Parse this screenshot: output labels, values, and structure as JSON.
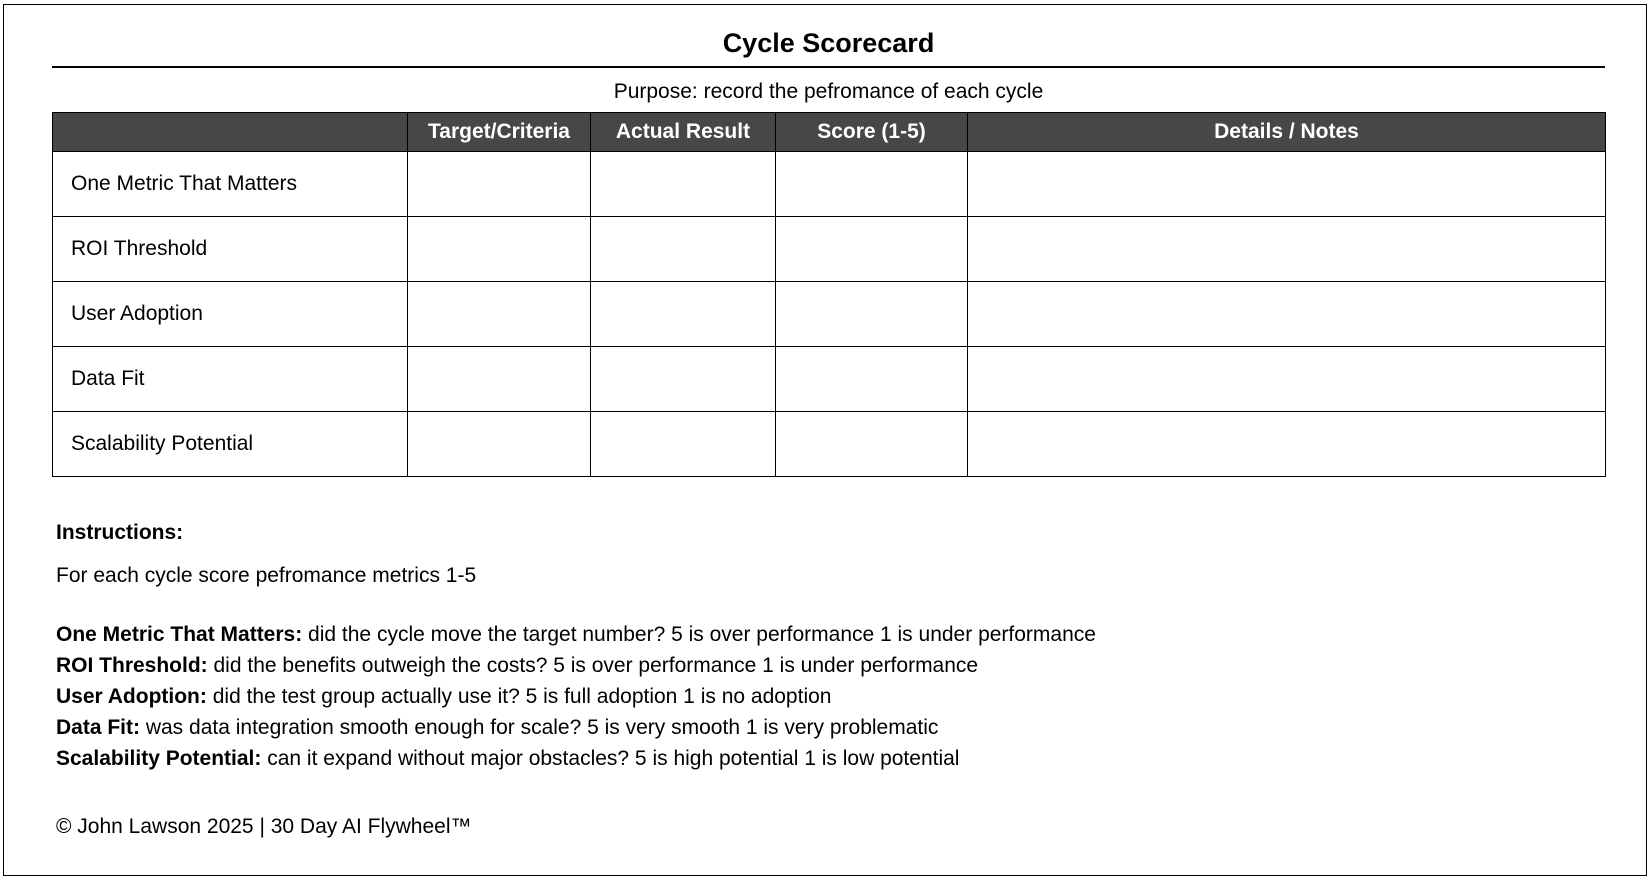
{
  "title": "Cycle Scorecard",
  "purpose": "Purpose: record the pefromance of each cycle",
  "table": {
    "headers": [
      "",
      "Target/Criteria",
      "Actual Result",
      "Score (1-5)",
      "Details / Notes"
    ],
    "rows": [
      {
        "label": "One Metric That Matters",
        "target": "",
        "actual": "",
        "score": "",
        "notes": ""
      },
      {
        "label": "ROI Threshold",
        "target": "",
        "actual": "",
        "score": "",
        "notes": ""
      },
      {
        "label": "User Adoption",
        "target": "",
        "actual": "",
        "score": "",
        "notes": ""
      },
      {
        "label": "Data Fit",
        "target": "",
        "actual": "",
        "score": "",
        "notes": ""
      },
      {
        "label": "Scalability Potential",
        "target": "",
        "actual": "",
        "score": "",
        "notes": ""
      }
    ]
  },
  "instructions": {
    "heading": "Instructions:",
    "intro": "For each cycle score pefromance metrics 1-5",
    "items": [
      {
        "term": "One Metric That Matters:",
        "text": " did the cycle move the target number? 5 is over performance 1 is under performance"
      },
      {
        "term": "ROI Threshold:",
        "text": " did the benefits outweigh the costs? 5 is over performance 1 is under performance"
      },
      {
        "term": "User Adoption:",
        "text": " did the test group actually use it? 5 is full adoption 1 is no adoption"
      },
      {
        "term": "Data Fit:",
        "text": " was data integration smooth enough for scale?  5 is very smooth 1 is very problematic"
      },
      {
        "term": "Scalability Potential:",
        "text": " can it expand without major obstacles? 5 is high potential 1 is low potential"
      }
    ]
  },
  "footer": "© John Lawson 2025 | 30 Day AI Flywheel™",
  "colors": {
    "header_bg": "#474747",
    "header_text": "#ffffff",
    "border": "#000000"
  }
}
